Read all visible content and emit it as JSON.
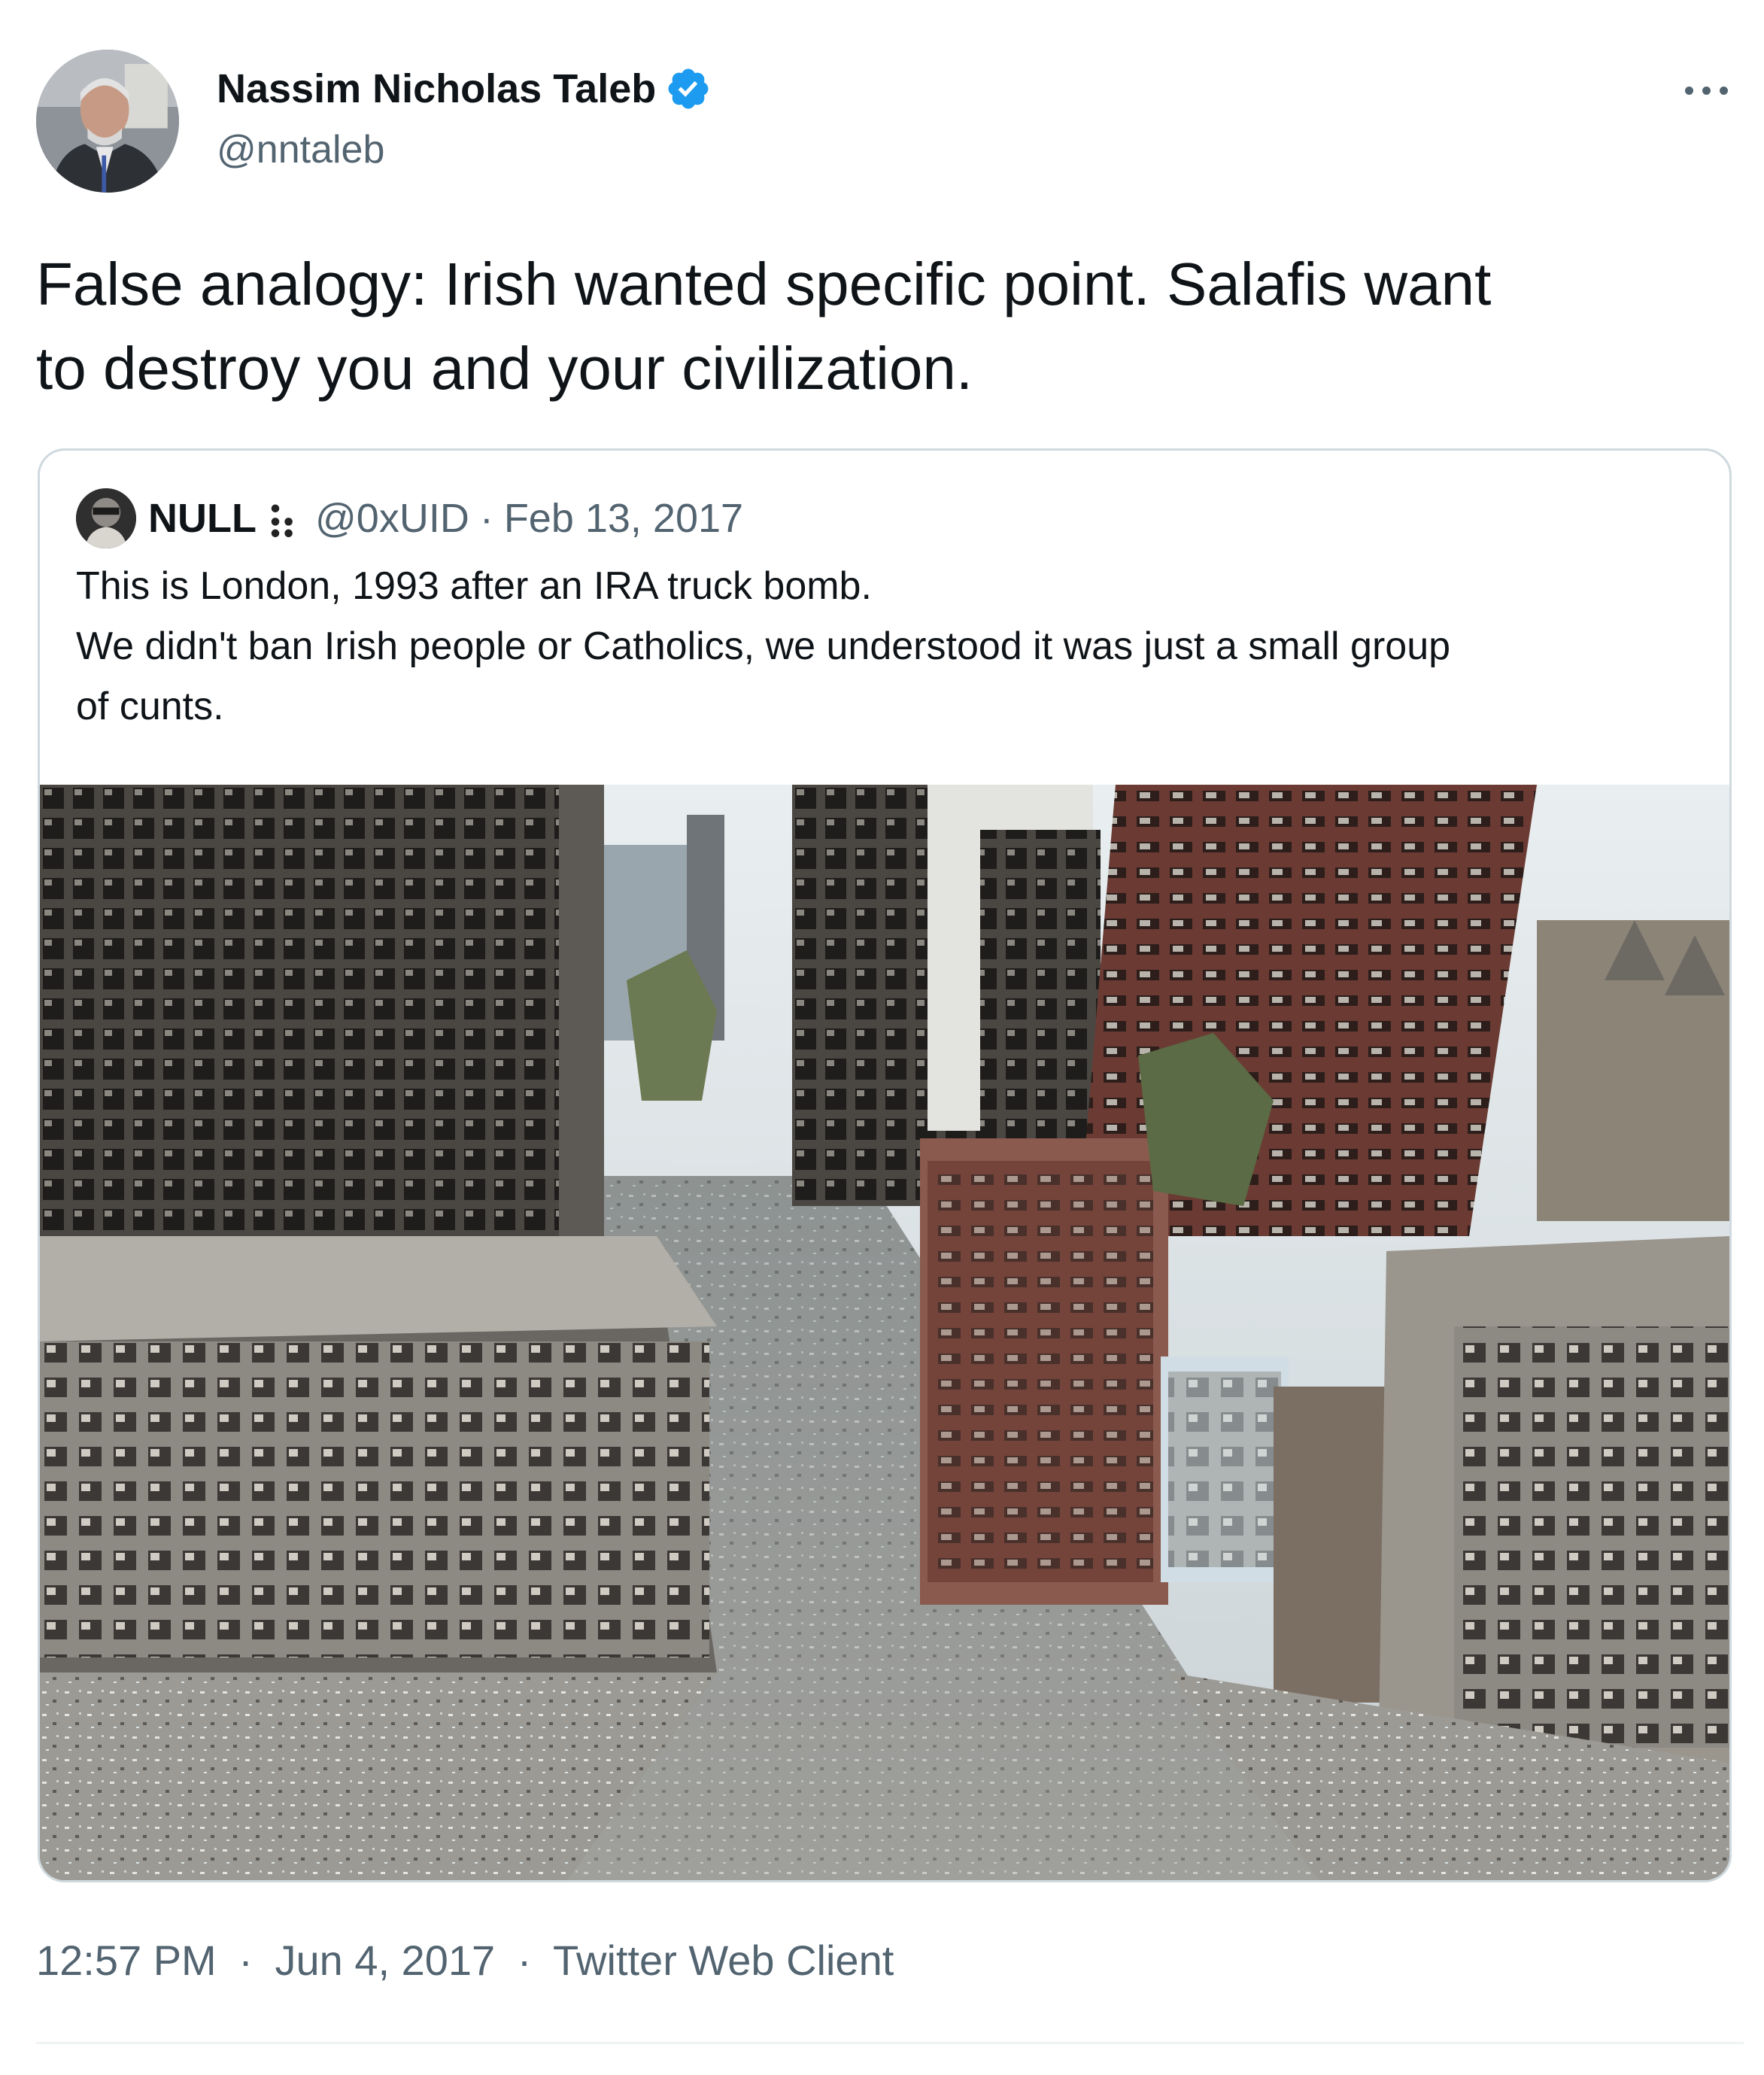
{
  "author": {
    "name": "Nassim Nicholas Taleb",
    "handle": "@nntaleb",
    "verified_icon": "verified-badge-icon",
    "verified_color": "#1d9bf0"
  },
  "tweet": {
    "text_line_1": "False analogy: Irish wanted specific point. Salafis want",
    "text_line_2": "to destroy you and your civilization."
  },
  "quoted": {
    "name": "NULL",
    "emoji_icon": "dots-emoji-icon",
    "handle": "@0xUID",
    "separator": "·",
    "date": "Feb 13, 2017",
    "text_line_1": "This is London, 1993 after an IRA truck bomb.",
    "text_line_2": "We didn't ban Irish people or Catholics, we understood it was just a small group",
    "text_line_3": "of cunts.",
    "image_alt": "bombed-city-street-photo"
  },
  "meta": {
    "time": "12:57 PM",
    "separator": "·",
    "date": "Jun 4, 2017",
    "source": "Twitter Web Client"
  },
  "colors": {
    "text_primary": "#0f1419",
    "text_secondary": "#536471",
    "border": "#cfd9de"
  }
}
